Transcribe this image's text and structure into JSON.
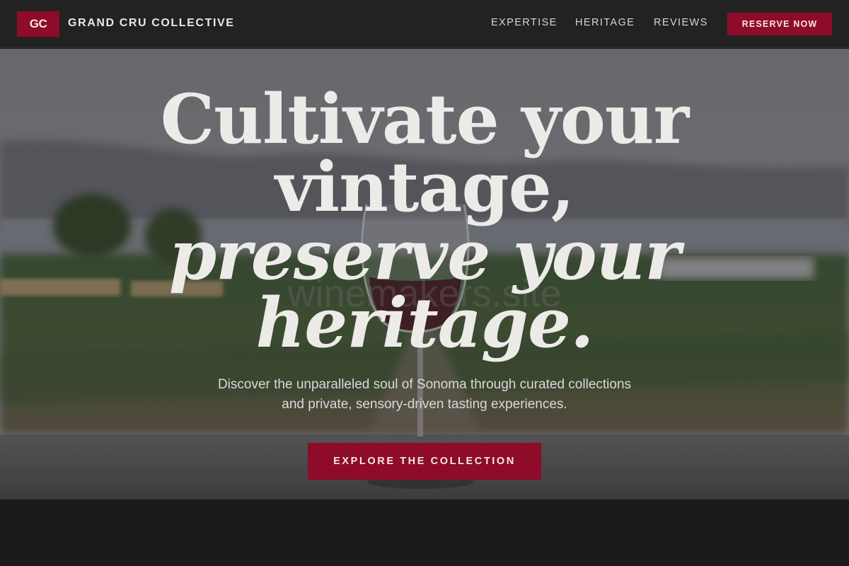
{
  "colors": {
    "accent": "#8e0b2a",
    "header_bg": "#222223",
    "page_bg": "#1b1b1c"
  },
  "header": {
    "logo_text": "GC",
    "brand_name": "GRAND CRU COLLECTIVE",
    "nav": [
      {
        "label": "EXPERTISE"
      },
      {
        "label": "HERITAGE"
      },
      {
        "label": "REVIEWS"
      }
    ],
    "cta_label": "RESERVE NOW"
  },
  "hero": {
    "headline": {
      "line1": "Cultivate your",
      "line2": "vintage,",
      "line3": "preserve your",
      "line4": "heritage."
    },
    "subtitle_line1": "Discover the unparalleled soul of Sonoma through curated collections",
    "subtitle_line2": "and private, sensory-driven tasting experiences.",
    "cta_label": "EXPLORE THE COLLECTION",
    "watermark": "winemakers.site"
  }
}
